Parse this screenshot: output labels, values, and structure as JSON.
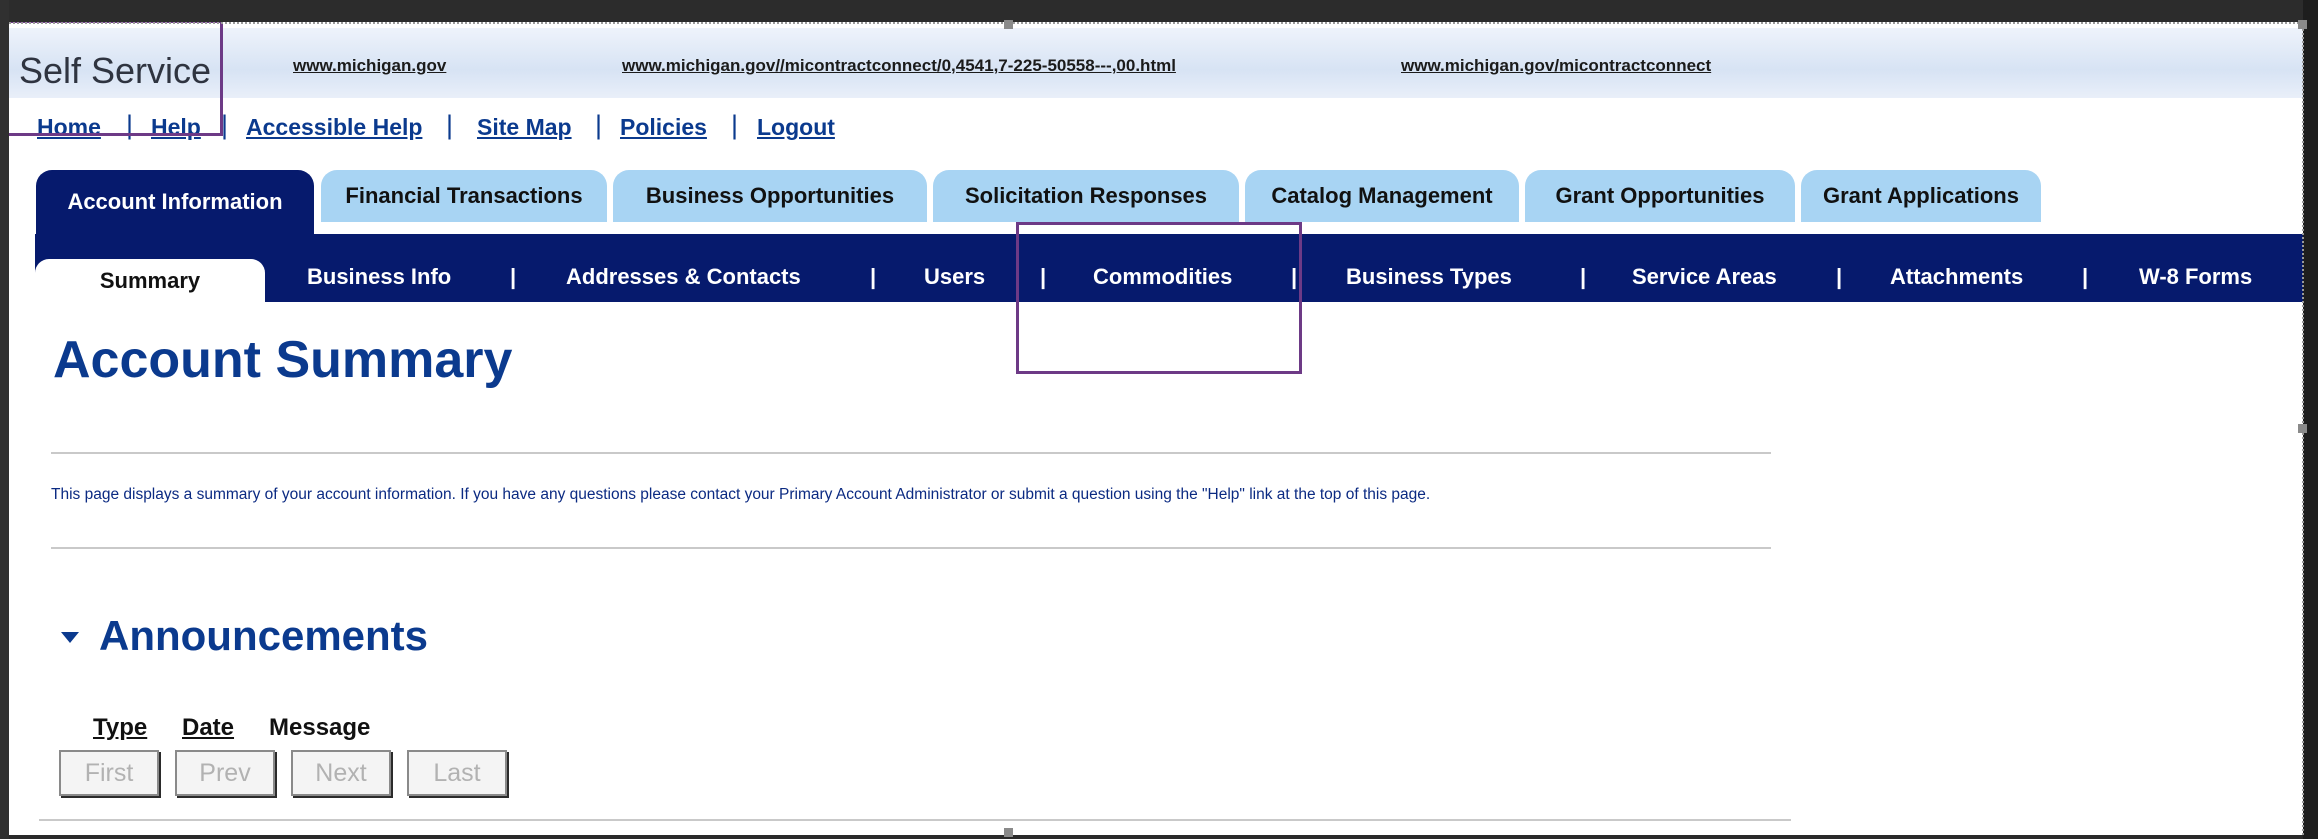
{
  "header": {
    "app_title": "r Self Service",
    "links": [
      "www.michigan.gov",
      "www.michigan.gov//micontractconnect/0,4541,7-225-50558---,00.html",
      "www.michigan.gov/micontractconnect"
    ]
  },
  "primary_nav": [
    "Home",
    "Help",
    "Accessible Help",
    "Site Map",
    "Policies",
    "Logout"
  ],
  "tabs": [
    "Account Information",
    "Financial Transactions",
    "Business Opportunities",
    "Solicitation Responses",
    "Catalog Management",
    "Grant Opportunities",
    "Grant Applications"
  ],
  "subnav": {
    "active": "Summary",
    "items": [
      "Business Info",
      "Addresses & Contacts",
      "Users",
      "Commodities",
      "Business Types",
      "Service Areas",
      "Attachments",
      "W-8 Forms"
    ],
    "separator": "|"
  },
  "page": {
    "title": "Account Summary",
    "description": "This page displays a summary of your account information. If you have any questions please contact your Primary Account Administrator or submit a question using the \"Help\" link at the top of this page."
  },
  "announcements": {
    "title": "Announcements",
    "columns": [
      "Type",
      "Date",
      "Message"
    ],
    "pager": [
      "First",
      "Prev",
      "Next",
      "Last"
    ]
  },
  "colors": {
    "nav_dark": "#061a6d",
    "tab_light": "#a8d4f3",
    "heading_blue": "#0b3a8e",
    "annotation": "#6d3a86"
  }
}
